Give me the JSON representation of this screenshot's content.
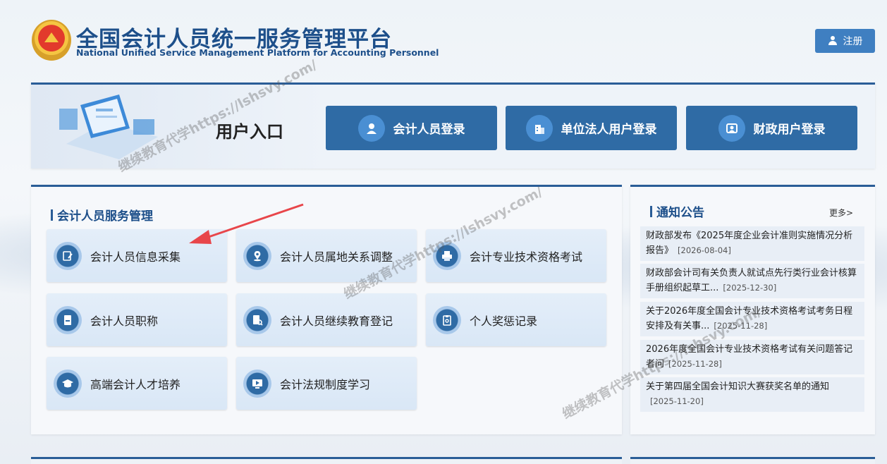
{
  "header": {
    "title_cn": "全国会计人员统一服务管理平台",
    "title_en": "National Unified Service Management Platform for Accounting Personnel",
    "register_label": "注册"
  },
  "login": {
    "entry_title": "用户入口",
    "buttons": [
      {
        "label": "会计人员登录",
        "icon": "user-icon"
      },
      {
        "label": "单位法人用户登录",
        "icon": "building-icon"
      },
      {
        "label": "财政用户登录",
        "icon": "id-card-icon"
      }
    ]
  },
  "services": {
    "title": "会计人员服务管理",
    "tiles": [
      {
        "label": "会计人员信息采集",
        "icon": "edit-form-icon"
      },
      {
        "label": "会计人员属地关系调整",
        "icon": "location-icon"
      },
      {
        "label": "会计专业技术资格考试",
        "icon": "printer-icon"
      },
      {
        "label": "会计人员职称",
        "icon": "document-icon"
      },
      {
        "label": "会计人员继续教育登记",
        "icon": "search-document-icon"
      },
      {
        "label": "个人奖惩记录",
        "icon": "clipboard-icon"
      },
      {
        "label": "高端会计人才培养",
        "icon": "graduation-cap-icon"
      },
      {
        "label": "会计法规制度学习",
        "icon": "video-icon"
      }
    ]
  },
  "notices": {
    "title": "通知公告",
    "more_label": "更多>",
    "items": [
      {
        "text": "财政部发布《2025年度企业会计准则实施情况分析报告》",
        "date": "[2026-08-04]"
      },
      {
        "text": "财政部会计司有关负责人就试点先行类行业会计核算手册组织起草工...",
        "date": "[2025-12-30]"
      },
      {
        "text": "关于2026年度全国会计专业技术资格考试考务日程安排及有关事...",
        "date": "[2025-11-28]"
      },
      {
        "text": "2026年度全国会计专业技术资格考试有关问题答记者问",
        "date": "[2025-11-28]"
      },
      {
        "text": "关于第四届全国会计知识大赛获奖名单的通知",
        "date": "[2025-11-20]"
      }
    ]
  },
  "watermark": "继续教育代学https://lshsvy.com/",
  "colors": {
    "primary": "#2f6ba5",
    "accent": "#3f7fc1",
    "title": "#1d4f8a",
    "arrow": "#e8464a"
  }
}
